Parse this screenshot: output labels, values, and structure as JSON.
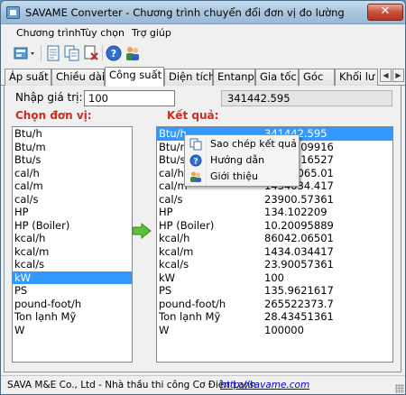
{
  "window": {
    "title": "SAVAME Converter - Chương trình chuyển đổi đơn vị đo lường",
    "close_label": "✕"
  },
  "menu": [
    {
      "label": "Chương trình"
    },
    {
      "label": "Tùy chọn"
    },
    {
      "label": "Trợ giúp"
    }
  ],
  "toolbar": {
    "icons": [
      "app-menu-icon",
      "document-icon",
      "copy-icon",
      "page-close-icon",
      "help-icon",
      "users-icon"
    ]
  },
  "tabs": [
    {
      "label": "Áp suất"
    },
    {
      "label": "Chiều dài"
    },
    {
      "label": "Công suất",
      "active": true
    },
    {
      "label": "Diện tích"
    },
    {
      "label": "Entanpi"
    },
    {
      "label": "Gia tốc"
    },
    {
      "label": "Góc"
    },
    {
      "label": "Khối lư"
    }
  ],
  "input": {
    "label": "Nhập giá trị:",
    "value": "100",
    "result": "341442.595"
  },
  "headers": {
    "choose_unit": "Chọn đơn vị:",
    "result": "Kết quả:"
  },
  "units": [
    "Btu/h",
    "Btu/m",
    "Btu/s",
    "cal/h",
    "cal/m",
    "cal/s",
    "HP",
    "HP (Boiler)",
    "kcal/h",
    "kcal/m",
    "kcal/s",
    "kW",
    "PS",
    "pound-foot/h",
    "Ton lạnh Mỹ",
    "W"
  ],
  "selected_unit": "kW",
  "results": [
    {
      "unit": "Btu/h",
      "value": "341442.595"
    },
    {
      "unit": "Btu/m",
      "value": "5690.709916"
    },
    {
      "unit": "Btu/s",
      "value": "94.84516527"
    },
    {
      "unit": "cal/h",
      "value": "86042065.01"
    },
    {
      "unit": "cal/m",
      "value": "1434034.417"
    },
    {
      "unit": "cal/s",
      "value": "23900.57361"
    },
    {
      "unit": "HP",
      "value": "134.102209"
    },
    {
      "unit": "HP (Boiler)",
      "value": "10.20095889"
    },
    {
      "unit": "kcal/h",
      "value": "86042.06501"
    },
    {
      "unit": "kcal/m",
      "value": "1434.034417"
    },
    {
      "unit": "kcal/s",
      "value": "23.90057361"
    },
    {
      "unit": "kW",
      "value": "100"
    },
    {
      "unit": "PS",
      "value": "135.9621617"
    },
    {
      "unit": "pound-foot/h",
      "value": "265522373.7"
    },
    {
      "unit": "Ton lạnh Mỹ",
      "value": "28.43451361"
    },
    {
      "unit": "W",
      "value": "100000"
    }
  ],
  "context_menu": [
    {
      "label": "Sao chép kết quả",
      "icon": "copy-icon"
    },
    {
      "label": "Hướng dẫn",
      "icon": "help-icon"
    },
    {
      "label": "Giới thiệu",
      "icon": "users-icon"
    }
  ],
  "status": {
    "text": "SAVA M&E Co., Ltd - Nhà thầu thi công Cơ Điện Lạnh",
    "link": "http://savame.com"
  },
  "colors": {
    "accent_red": "#d12a1e",
    "selection": "#3399ff",
    "link": "#0000ee"
  }
}
